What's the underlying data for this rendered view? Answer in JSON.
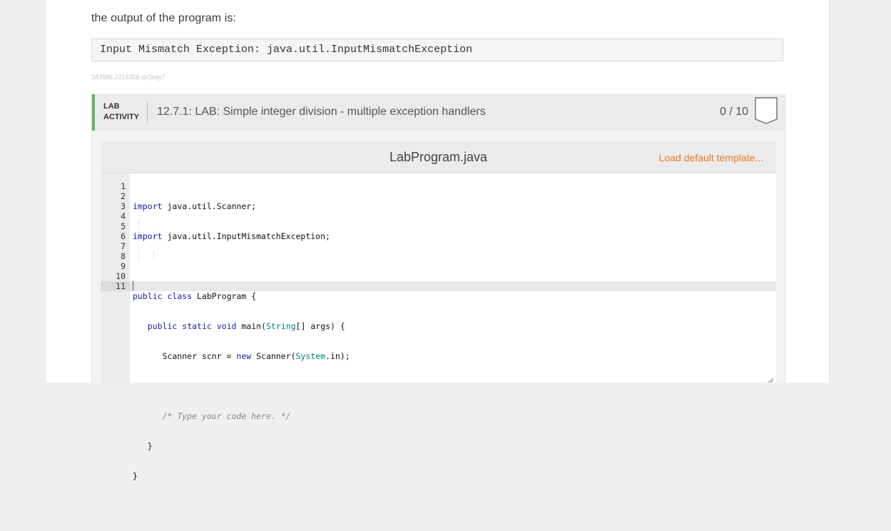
{
  "intro": {
    "text": "the output of the program is:"
  },
  "output_example": {
    "text": "Input Mismatch Exception: java.util.InputMismatchException"
  },
  "content_id": "343586.2214356.qx3zqy7",
  "lab": {
    "tag_line1": "LAB",
    "tag_line2": "ACTIVITY",
    "title": "12.7.1: LAB: Simple integer division - multiple exception handlers",
    "score": "0 / 10",
    "accent_color": "#5cb85c"
  },
  "editor": {
    "file_name": "LabProgram.java",
    "load_template_label": "Load default template...",
    "load_template_color": "#e87722",
    "line_numbers": [
      "1",
      "2",
      "3",
      "4",
      "5",
      "6",
      "7",
      "8",
      "9",
      "10",
      "11"
    ],
    "code": [
      "import java.util.Scanner;",
      "import java.util.InputMismatchException;",
      "",
      "public class LabProgram {",
      "   public static void main(String[] args) {",
      "      Scanner scnr = new Scanner(System.in);",
      "",
      "      /* Type your code here. */",
      "   }",
      "}",
      ""
    ]
  }
}
